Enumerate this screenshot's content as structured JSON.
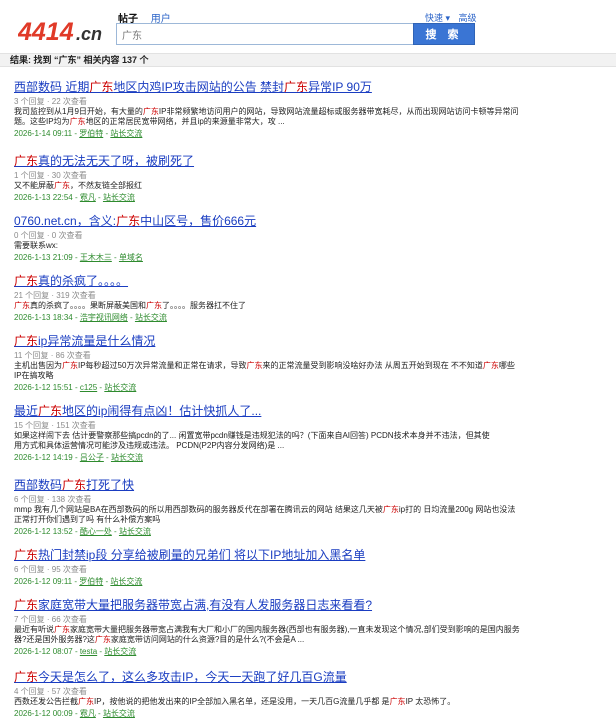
{
  "header": {
    "logo_text": "4414.cn",
    "tab_active": "帖子",
    "tab_user": "用户",
    "search_value": "广东",
    "search_button": "搜 索",
    "link_quick": "快速 ▾",
    "link_advanced": "高级"
  },
  "result_bar": {
    "prefix": "结果: 找到 “",
    "keyword": "广东",
    "suffix": "” 相关内容 137 个"
  },
  "results": [
    {
      "title_parts": [
        "西部数码 近期",
        "广东",
        "地区内鸡IP攻击网站的公告 禁封",
        "广东",
        "异常IP 90万"
      ],
      "meta": "3 个回复 · 22 次查看",
      "snippet_lines": [
        [
          "我司监控到从1月9日开始，有大量的",
          "广东",
          "IP非常频繁地访问用户的网站，导致网站流量超标或服务器带宽耗尽，从而出现网站访问卡顿等异常问"
        ],
        [
          "题。这些IP均为",
          "广东",
          "地区的正常居民宽带网络，并且ip的来源量非常大，攻 ..."
        ]
      ],
      "date": "2026-1-14 09:11",
      "user": "罗伯特",
      "board": "站长交流"
    },
    {
      "title_parts": [
        "",
        "广东",
        "真的无法无天了呀，被刷死了"
      ],
      "meta": "1 个回复 · 30 次查看",
      "snippet_lines": [
        [
          "又不能屏蔽",
          "广东",
          "，不然友链全部报红"
        ]
      ],
      "date": "2026-1-13 22:54",
      "user": "霓凡",
      "board": "站长交流"
    },
    {
      "title_parts": [
        "0760.net.cn，含义:",
        "广东",
        "中山区号，售价666元"
      ],
      "meta": "0 个回复 · 0 次查看",
      "snippet_lines": [
        [
          "需要联系wx:"
        ]
      ],
      "date": "2026-1-13 21:09",
      "user": "王木木三",
      "board": "单域名"
    },
    {
      "title_parts": [
        "",
        "广东",
        "真的杀疯了。。。。"
      ],
      "meta": "21 个回复 · 319 次查看",
      "snippet_lines": [
        [
          "",
          "广东",
          "真的杀疯了。。。。果断屏蔽美国和",
          "广东",
          "了。。。。服务器扛不住了"
        ]
      ],
      "date": "2026-1-13 18:34",
      "user": "浩宇视讯网络",
      "board": "站长交流"
    },
    {
      "title_parts": [
        "",
        "广东",
        "ip异常流量是什么情况"
      ],
      "meta": "11 个回复 · 86 次查看",
      "snippet_lines": [
        [
          "主机出售因为",
          "广东",
          "IP每秒超过50万次异常流量和正常在请求，导致",
          "广东",
          "来的正常流量受到影响没啥好办法 从周五开始到现在 不不知道",
          "广东",
          "哪些"
        ],
        [
          "IP在搞攻略"
        ]
      ],
      "date": "2026-1-12 15:51",
      "user": "c125",
      "board": "站长交流"
    },
    {
      "title_parts": [
        "最近",
        "广东",
        "地区的ip闹得有点凶！估计快抓人了..."
      ],
      "meta": "15 个回复 · 151 次查看",
      "snippet_lines": [
        [
          "如果这样闹下去 估计要警察那些搞pcdn的了... 闲置宽带pcdn赚钱是违规犯法的吗？(下面来自AI回答)        PCDN技术本身并不违法，但其使"
        ],
        [
          "用方式和具体运营情况可能涉及违规或违法。        PCDN(P2P内容分发网络)是 ..."
        ]
      ],
      "date": "2026-1-12 14:19",
      "user": "吕公子",
      "board": "站长交流"
    },
    {
      "title_parts": [
        "西部数码",
        "广东",
        "打死了快"
      ],
      "meta": "6 个回复 · 138 次查看",
      "snippet_lines": [
        [
          "mmp 我有几个网站是BA在西部数码的所以用西部数码的服务器反代在部署在腾讯云的网站 结果这几天被",
          "广东",
          "ip打的 日均流量200g 网站也没法"
        ],
        [
          "正常打开你们遇到了吗 有什么补偿方案吗"
        ]
      ],
      "date": "2026-1-12 13:52",
      "user": "酷心一处",
      "board": "站长交流"
    },
    {
      "title_parts": [
        "",
        "广东",
        "热门封禁ip段 分享给被刷量的兄弟们 将以下IP地址加入黑名单"
      ],
      "meta": "6 个回复 · 95 次查看",
      "snippet_lines": [],
      "date": "2026-1-12 09:11",
      "user": "罗伯特",
      "board": "站长交流"
    },
    {
      "title_parts": [
        "",
        "广东",
        "家庭宽带大量把服务器带宽占满,有没有人发服务器日志来看看?"
      ],
      "meta": "7 个回复 · 66 次查看",
      "snippet_lines": [
        [
          "最近有听说",
          "广东",
          "家庭宽带大量把服务器带宽占满我有大厂和小厂的国内服务器(西部也有服务器),一直未发现这个情况,部们受到影响的是国内服务"
        ],
        [
          "器?还是国外服务器?这",
          "广东",
          "家庭宽带访问网站的什么资源?目的是什么?(不会是A ..."
        ]
      ],
      "date": "2026-1-12 08:07",
      "user": "testa",
      "board": "站长交流"
    },
    {
      "title_parts": [
        "",
        "广东",
        "今天是怎么了，这么多攻击IP，今天一天跑了好几百G流量"
      ],
      "meta": "4 个回复 · 57 次查看",
      "snippet_lines": [
        [
          "西数还发公告拦截",
          "广东",
          "IP，按他说的把他发出来的IP全部加入黑名单，还是没用，一天几百G流量几乎都 是",
          "广东",
          "IP 太恐怖了。"
        ]
      ],
      "date": "2026-1-12 00:09",
      "user": "霓凡",
      "board": "站长交流"
    }
  ],
  "colors": {
    "link": "#1a3dc1",
    "highlight": "#c00000",
    "logo": "#e03a28",
    "footer_green": "#2e8b2e",
    "button": "#3a75d4"
  }
}
